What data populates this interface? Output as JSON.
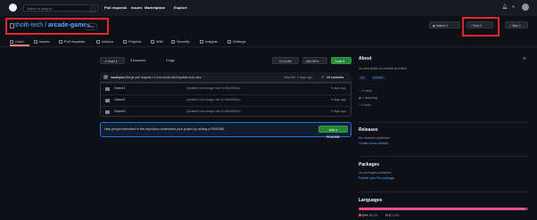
{
  "topnav": {
    "search_placeholder": "Search or jump to...",
    "search_shortcut": "/",
    "links": [
      "Pull requests",
      "Issues",
      "Marketplace",
      "Explore"
    ],
    "right_icons": [
      "bell-icon",
      "plus-icon",
      "avatar"
    ]
  },
  "repo": {
    "owner": "thoth-tech",
    "separator": "/",
    "name": "arcade-games",
    "visibility": "Public"
  },
  "header_buttons": {
    "watch": {
      "label": "Watch",
      "count": "0"
    },
    "fork": {
      "label": "Fork",
      "count": "0"
    },
    "star": {
      "label": "Star",
      "count": "0"
    }
  },
  "tabs": [
    {
      "label": "Code",
      "icon": "code-icon"
    },
    {
      "label": "Issues",
      "icon": "issue-icon"
    },
    {
      "label": "Pull requests",
      "icon": "pr-icon"
    },
    {
      "label": "Actions",
      "icon": "play-icon"
    },
    {
      "label": "Projects",
      "icon": "table-icon"
    },
    {
      "label": "Wiki",
      "icon": "book-icon"
    },
    {
      "label": "Security",
      "icon": "shield-icon"
    },
    {
      "label": "Insights",
      "icon": "graph-icon"
    },
    {
      "label": "Settings",
      "icon": "gear-icon"
    }
  ],
  "toolbar": {
    "branch": "main",
    "branches": "5 branches",
    "tags": "0 tags",
    "go_to_file": "Go to file",
    "add_file": "Add file",
    "code": "Code"
  },
  "commit": {
    "author": "sarahpos",
    "message": "Merge pull request",
    "pr_number": "#4",
    "pr_source": "from thoth-tech/update-icon-size",
    "hash": "a9ac966",
    "when": "9 days ago",
    "commits": "19 commits"
  },
  "files": [
    {
      "name": "Game1",
      "message": "Updated icon image size to 600x600px",
      "date": "9 days ago"
    },
    {
      "name": "Game2",
      "message": "Updated icon image size to 600x600px",
      "date": "9 days ago"
    },
    {
      "name": "Game3",
      "message": "Updated icon image size to 600x600px",
      "date": "9 days ago"
    }
  ],
  "readme_prompt": {
    "text": "Help people interested in this repository understand your project by adding a README.",
    "button": "Add a README"
  },
  "about": {
    "title": "About",
    "description": "No description or website provided.",
    "topics": [
      "cpp",
      "splashkit"
    ],
    "stats": [
      "0 stars",
      "1 watching",
      "0 forks"
    ]
  },
  "releases": {
    "title": "Releases",
    "text": "No releases published",
    "link": "Create a new release"
  },
  "packages": {
    "title": "Packages",
    "text": "No packages published",
    "link": "Publish your first package"
  },
  "languages": {
    "title": "Languages",
    "items": [
      {
        "name": "C++",
        "percent": "98.2%",
        "value": 98.2,
        "color": "#f34b7d"
      },
      {
        "name": "C",
        "percent": "1.8%",
        "value": 1.8,
        "color": "#555555"
      }
    ]
  },
  "colors": {
    "highlight": "#e5252a",
    "link": "#58a6ff",
    "green": "#238636"
  }
}
